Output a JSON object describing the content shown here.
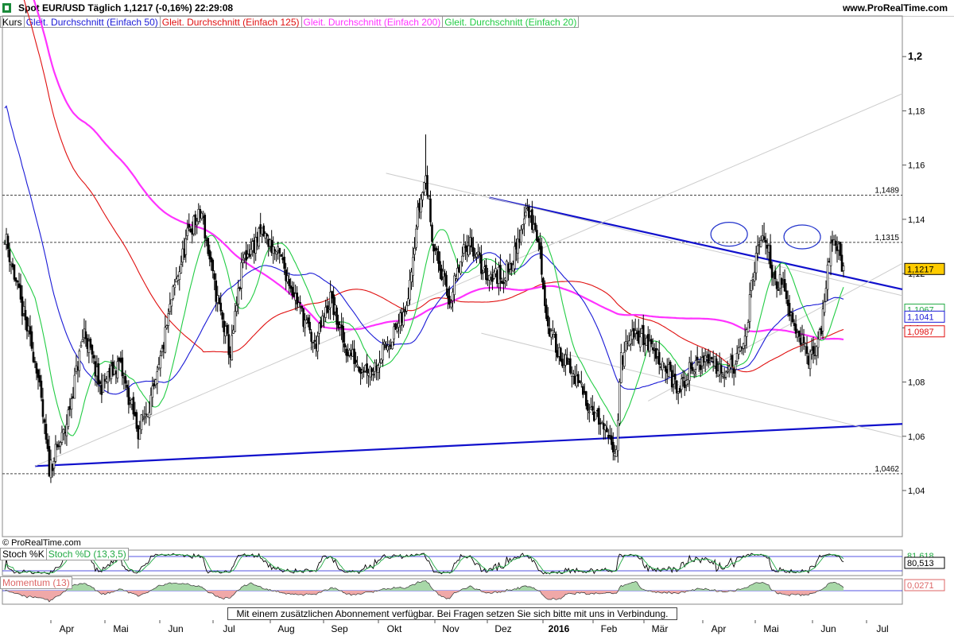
{
  "header": {
    "title": "Spot EUR/USD   Täglich   1,1217 (-0,16%)   22:29:08",
    "site": "www.ProRealTime.com"
  },
  "legend": [
    {
      "label": "Kurs",
      "color": "#000000"
    },
    {
      "label": "Gleit. Durchschnitt (Einfach 50)",
      "color": "#1a1ad6"
    },
    {
      "label": "Gleit. Durchschnitt (Einfach 125)",
      "color": "#e01010"
    },
    {
      "label": "Gleit. Durchschnitt (Einfach 200)",
      "color": "#ff33ff"
    },
    {
      "label": "Gleit. Durchschnitt (Einfach 20)",
      "color": "#22cc44"
    }
  ],
  "copyright": "© ProRealTime.com",
  "notice": "Mit einem zusätzlichen Abonnement verfügbar. Bei Fragen setzen Sie sich bitte mit uns in Verbindung.",
  "stoch": {
    "label_k": "Stoch %K",
    "label_d": "Stoch %D (13,3,5)",
    "value_k": "80,513",
    "value_d": "81,618"
  },
  "momentum": {
    "label": "Momentum (13)",
    "value": "0,0271"
  },
  "chart_data": {
    "type": "candlestick",
    "x_labels": [
      "Apr",
      "Mai",
      "Jun",
      "Jul",
      "Aug",
      "Sep",
      "Okt",
      "Nov",
      "Dez",
      "2016",
      "Feb",
      "Mär",
      "Apr",
      "Mai",
      "Jun",
      "Jul"
    ],
    "y_ticks": [
      "1,04",
      "1,06",
      "1,08",
      "1,1",
      "1,12",
      "1,14",
      "1,16",
      "1,18",
      "1,2"
    ],
    "ylim": [
      1.023,
      1.215
    ],
    "price_anchors": [
      [
        0,
        1.1345
      ],
      [
        10,
        1.109
      ],
      [
        20,
        1.086
      ],
      [
        28,
        1.048
      ],
      [
        38,
        1.062
      ],
      [
        50,
        1.099
      ],
      [
        60,
        1.078
      ],
      [
        72,
        1.087
      ],
      [
        84,
        1.062
      ],
      [
        95,
        1.078
      ],
      [
        105,
        1.11
      ],
      [
        116,
        1.136
      ],
      [
        124,
        1.142
      ],
      [
        132,
        1.115
      ],
      [
        142,
        1.09
      ],
      [
        150,
        1.125
      ],
      [
        162,
        1.135
      ],
      [
        174,
        1.125
      ],
      [
        184,
        1.11
      ],
      [
        195,
        1.093
      ],
      [
        205,
        1.111
      ],
      [
        214,
        1.093
      ],
      [
        224,
        1.086
      ],
      [
        232,
        1.085
      ],
      [
        242,
        1.095
      ],
      [
        252,
        1.105
      ],
      [
        260,
        1.142
      ],
      [
        265,
        1.156
      ],
      [
        270,
        1.13
      ],
      [
        280,
        1.11
      ],
      [
        292,
        1.133
      ],
      [
        302,
        1.12
      ],
      [
        314,
        1.119
      ],
      [
        322,
        1.128
      ],
      [
        328,
        1.145
      ],
      [
        336,
        1.132
      ],
      [
        342,
        1.1
      ],
      [
        350,
        1.09
      ],
      [
        360,
        1.08
      ],
      [
        372,
        1.068
      ],
      [
        380,
        1.058
      ],
      [
        385,
        1.056
      ],
      [
        388,
        1.088
      ],
      [
        394,
        1.096
      ],
      [
        400,
        1.098
      ],
      [
        408,
        1.092
      ],
      [
        416,
        1.086
      ],
      [
        424,
        1.076
      ],
      [
        432,
        1.085
      ],
      [
        442,
        1.089
      ],
      [
        452,
        1.085
      ],
      [
        460,
        1.086
      ],
      [
        466,
        1.096
      ],
      [
        472,
        1.123
      ],
      [
        478,
        1.135
      ],
      [
        484,
        1.119
      ],
      [
        490,
        1.115
      ],
      [
        496,
        1.104
      ],
      [
        502,
        1.095
      ],
      [
        506,
        1.088
      ],
      [
        510,
        1.09
      ],
      [
        514,
        1.1
      ],
      [
        518,
        1.123
      ],
      [
        522,
        1.133
      ],
      [
        526,
        1.126
      ],
      [
        528,
        1.1217
      ]
    ],
    "series": [
      {
        "name": "Gleit. Durchschnitt (Einfach 50)",
        "last": "1,1041",
        "color": "#1a1ad6"
      },
      {
        "name": "Gleit. Durchschnitt (Einfach 125)",
        "last": "1,0987",
        "color": "#e01010"
      },
      {
        "name": "Gleit. Durchschnitt (Einfach 200)",
        "last": "1,1067",
        "color": "#ff33ff"
      },
      {
        "name": "Gleit. Durchschnitt (Einfach 20)",
        "last": "1,1067",
        "color": "#22cc44"
      }
    ],
    "last_price": "1,1217",
    "hlines": [
      {
        "value": 1.1489,
        "label": "1,1489"
      },
      {
        "value": 1.1315,
        "label": "1,1315"
      },
      {
        "value": 1.0462,
        "label": "1,0462"
      }
    ],
    "trendlines": [
      {
        "from": [
          19,
          1.049
        ],
        "to": [
          528,
          1.0635
        ],
        "color": "#1010cc"
      },
      {
        "from": [
          305,
          1.148
        ],
        "to": [
          528,
          1.119
        ],
        "color": "#1010cc"
      },
      {
        "from": [
          19,
          1.049
        ],
        "to": [
          528,
          1.177
        ],
        "color": "#cccccc"
      },
      {
        "from": [
          240,
          1.157
        ],
        "to": [
          528,
          1.117
        ],
        "color": "#cccccc"
      },
      {
        "from": [
          300,
          1.098
        ],
        "to": [
          528,
          1.065
        ],
        "color": "#cccccc"
      },
      {
        "from": [
          405,
          1.073
        ],
        "to": [
          528,
          1.112
        ],
        "color": "#cccccc"
      }
    ],
    "ellipses": [
      {
        "x": 456,
        "y": 1.1345
      },
      {
        "x": 502,
        "y": 1.1335
      }
    ],
    "grid": false
  }
}
